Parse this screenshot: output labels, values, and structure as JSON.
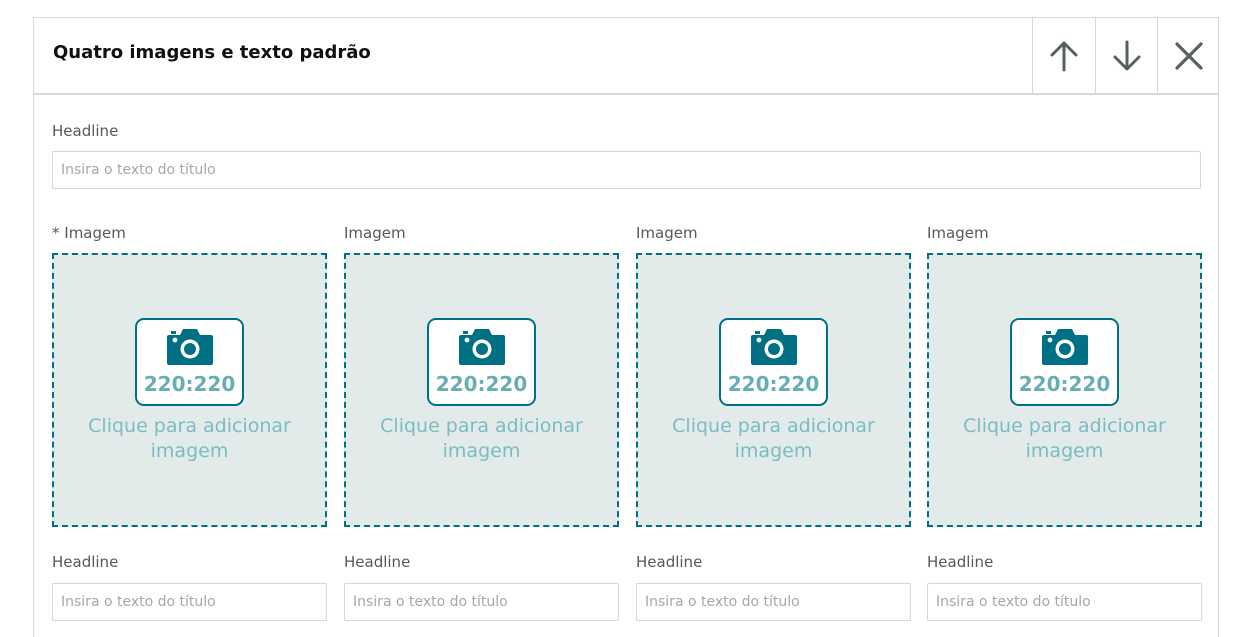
{
  "module": {
    "title": "Quatro imagens e texto padrão",
    "headline_label": "Headline",
    "headline_placeholder": "Insira o texto do título"
  },
  "header_icons": {
    "up": "arrow-up-icon",
    "down": "arrow-down-icon",
    "close": "close-icon"
  },
  "images": [
    {
      "label": "* Imagem",
      "ratio": "220:220",
      "upload_text": "Clique para adicionar imagem",
      "headline_label": "Headline",
      "headline_placeholder": "Insira o texto do título"
    },
    {
      "label": "Imagem",
      "ratio": "220:220",
      "upload_text": "Clique para adicionar imagem",
      "headline_label": "Headline",
      "headline_placeholder": "Insira o texto do título"
    },
    {
      "label": "Imagem",
      "ratio": "220:220",
      "upload_text": "Clique para adicionar imagem",
      "headline_label": "Headline",
      "headline_placeholder": "Insira o texto do título"
    },
    {
      "label": "Imagem",
      "ratio": "220:220",
      "upload_text": "Clique para adicionar imagem",
      "headline_label": "Headline",
      "headline_placeholder": "Insira o texto do título"
    }
  ],
  "colors": {
    "accent": "#007185",
    "upload_bg": "#e3ebea",
    "upload_text": "#7bbcc0",
    "icon_gray": "#566060"
  }
}
